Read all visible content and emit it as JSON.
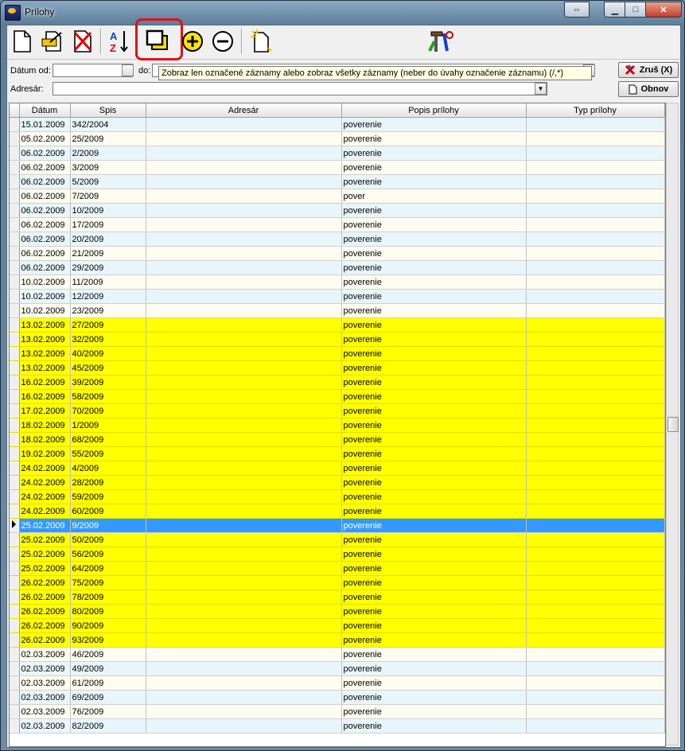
{
  "window": {
    "title": "Prílohy"
  },
  "toolbar": {
    "items": [
      "new-document-icon",
      "edit-document-icon",
      "delete-document-icon",
      "sort-az-icon",
      "toggle-marked-icon",
      "mark-add-icon",
      "mark-remove-icon",
      "new-attachment-icon",
      "tools-icon"
    ]
  },
  "tooltip": {
    "text": "Zobraz len označené záznamy alebo zobraz všetky záznamy (neber do úvahy označenie záznamu) (/,*)"
  },
  "filters": {
    "date_from_label": "Dátum od:",
    "date_to_label": "do:",
    "addressee_label": "Adresár:",
    "date_from_value": "",
    "addressee_value": ""
  },
  "buttons": {
    "cancel_label": "Zruš (X)",
    "refresh_label": "Obnov"
  },
  "table": {
    "columns": [
      "Dátum",
      "Spis",
      "Adresár",
      "Popis prílohy",
      "Typ prílohy"
    ],
    "rows": [
      {
        "date": "15.01.2009",
        "file": "342/2004",
        "addr": "",
        "desc": "poverenie",
        "type": "",
        "marked": false
      },
      {
        "date": "05.02.2009",
        "file": "25/2009",
        "addr": "",
        "desc": "poverenie",
        "type": "",
        "marked": false
      },
      {
        "date": "06.02.2009",
        "file": "2/2009",
        "addr": "",
        "desc": "poverenie",
        "type": "",
        "marked": false
      },
      {
        "date": "06.02.2009",
        "file": "3/2009",
        "addr": "",
        "desc": "poverenie",
        "type": "",
        "marked": false
      },
      {
        "date": "06.02.2009",
        "file": "5/2009",
        "addr": "",
        "desc": "poverenie",
        "type": "",
        "marked": false
      },
      {
        "date": "06.02.2009",
        "file": "7/2009",
        "addr": "",
        "desc": "pover",
        "type": "",
        "marked": false
      },
      {
        "date": "06.02.2009",
        "file": "10/2009",
        "addr": "",
        "desc": "poverenie",
        "type": "",
        "marked": false
      },
      {
        "date": "06.02.2009",
        "file": "17/2009",
        "addr": "",
        "desc": "poverenie",
        "type": "",
        "marked": false
      },
      {
        "date": "06.02.2009",
        "file": "20/2009",
        "addr": "",
        "desc": "poverenie",
        "type": "",
        "marked": false
      },
      {
        "date": "06.02.2009",
        "file": "21/2009",
        "addr": "",
        "desc": "poverenie",
        "type": "",
        "marked": false
      },
      {
        "date": "06.02.2009",
        "file": "29/2009",
        "addr": "",
        "desc": "poverenie",
        "type": "",
        "marked": false
      },
      {
        "date": "10.02.2009",
        "file": "11/2009",
        "addr": "",
        "desc": "poverenie",
        "type": "",
        "marked": false
      },
      {
        "date": "10.02.2009",
        "file": "12/2009",
        "addr": "",
        "desc": "poverenie",
        "type": "",
        "marked": false
      },
      {
        "date": "10.02.2009",
        "file": "23/2009",
        "addr": "",
        "desc": "poverenie",
        "type": "",
        "marked": false
      },
      {
        "date": "13.02.2009",
        "file": "27/2009",
        "addr": "",
        "desc": "poverenie",
        "type": "",
        "marked": true
      },
      {
        "date": "13.02.2009",
        "file": "32/2009",
        "addr": "",
        "desc": "poverenie",
        "type": "",
        "marked": true
      },
      {
        "date": "13.02.2009",
        "file": "40/2009",
        "addr": "",
        "desc": "poverenie",
        "type": "",
        "marked": true
      },
      {
        "date": "13.02.2009",
        "file": "45/2009",
        "addr": "",
        "desc": "poverenie",
        "type": "",
        "marked": true
      },
      {
        "date": "16.02.2009",
        "file": "39/2009",
        "addr": "",
        "desc": "poverenie",
        "type": "",
        "marked": true
      },
      {
        "date": "16.02.2009",
        "file": "58/2009",
        "addr": "",
        "desc": "poverenie",
        "type": "",
        "marked": true
      },
      {
        "date": "17.02.2009",
        "file": "70/2009",
        "addr": "",
        "desc": "poverenie",
        "type": "",
        "marked": true
      },
      {
        "date": "18.02.2009",
        "file": "1/2009",
        "addr": "",
        "desc": "poverenie",
        "type": "",
        "marked": true
      },
      {
        "date": "18.02.2009",
        "file": "68/2009",
        "addr": "",
        "desc": "poverenie",
        "type": "",
        "marked": true
      },
      {
        "date": "19.02.2009",
        "file": "55/2009",
        "addr": "",
        "desc": "poverenie",
        "type": "",
        "marked": true
      },
      {
        "date": "24.02.2009",
        "file": "4/2009",
        "addr": "",
        "desc": "poverenie",
        "type": "",
        "marked": true
      },
      {
        "date": "24.02.2009",
        "file": "28/2009",
        "addr": "",
        "desc": "poverenie",
        "type": "",
        "marked": true
      },
      {
        "date": "24.02.2009",
        "file": "59/2009",
        "addr": "",
        "desc": "poverenie",
        "type": "",
        "marked": true
      },
      {
        "date": "24.02.2009",
        "file": "60/2009",
        "addr": "",
        "desc": "poverenie",
        "type": "",
        "marked": true
      },
      {
        "date": "25.02.2009",
        "file": "9/2009",
        "addr": "",
        "desc": "poverenie",
        "type": "",
        "marked": true,
        "selected": true
      },
      {
        "date": "25.02.2009",
        "file": "50/2009",
        "addr": "",
        "desc": "poverenie",
        "type": "",
        "marked": true
      },
      {
        "date": "25.02.2009",
        "file": "56/2009",
        "addr": "",
        "desc": "poverenie",
        "type": "",
        "marked": true
      },
      {
        "date": "25.02.2009",
        "file": "64/2009",
        "addr": "",
        "desc": "poverenie",
        "type": "",
        "marked": true
      },
      {
        "date": "26.02.2009",
        "file": "75/2009",
        "addr": "",
        "desc": "poverenie",
        "type": "",
        "marked": true
      },
      {
        "date": "26.02.2009",
        "file": "78/2009",
        "addr": "",
        "desc": "poverenie",
        "type": "",
        "marked": true
      },
      {
        "date": "26.02.2009",
        "file": "80/2009",
        "addr": "",
        "desc": "poverenie",
        "type": "",
        "marked": true
      },
      {
        "date": "26.02.2009",
        "file": "90/2009",
        "addr": "",
        "desc": "poverenie",
        "type": "",
        "marked": true
      },
      {
        "date": "26.02.2009",
        "file": "93/2009",
        "addr": "",
        "desc": "poverenie",
        "type": "",
        "marked": true
      },
      {
        "date": "02.03.2009",
        "file": "46/2009",
        "addr": "",
        "desc": "poverenie",
        "type": "",
        "marked": false
      },
      {
        "date": "02.03.2009",
        "file": "49/2009",
        "addr": "",
        "desc": "poverenie",
        "type": "",
        "marked": false
      },
      {
        "date": "02.03.2009",
        "file": "61/2009",
        "addr": "",
        "desc": "poverenie",
        "type": "",
        "marked": false
      },
      {
        "date": "02.03.2009",
        "file": "69/2009",
        "addr": "",
        "desc": "poverenie",
        "type": "",
        "marked": false
      },
      {
        "date": "02.03.2009",
        "file": "76/2009",
        "addr": "",
        "desc": "poverenie",
        "type": "",
        "marked": false
      },
      {
        "date": "02.03.2009",
        "file": "82/2009",
        "addr": "",
        "desc": "poverenie",
        "type": "",
        "marked": false
      }
    ]
  },
  "colors": {
    "marked_row": "#ffff00",
    "selected_row": "#3399ff",
    "highlight_box": "#e0101a"
  }
}
